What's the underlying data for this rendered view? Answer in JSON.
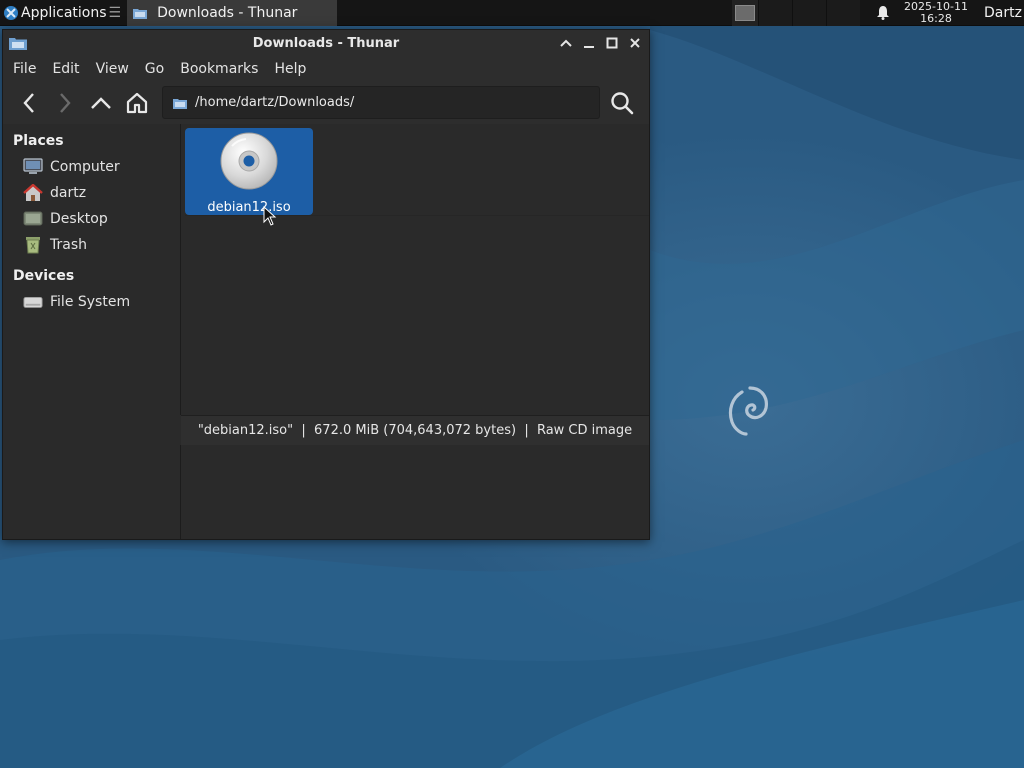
{
  "panel": {
    "applications_label": "Applications",
    "task_title": "Downloads - Thunar",
    "clock_date": "2025-10-11",
    "clock_time": "16:28",
    "user": "Dartz"
  },
  "window": {
    "title": "Downloads - Thunar",
    "controls": [
      "chevron-up-icon",
      "minimize-icon",
      "maximize-icon",
      "close-icon"
    ]
  },
  "menubar": {
    "items": [
      "File",
      "Edit",
      "View",
      "Go",
      "Bookmarks",
      "Help"
    ]
  },
  "toolbar": {
    "location": "/home/dartz/Downloads/"
  },
  "sidebar": {
    "places_header": "Places",
    "places": [
      {
        "label": "Computer",
        "icon": "computer-icon"
      },
      {
        "label": "dartz",
        "icon": "home-icon"
      },
      {
        "label": "Desktop",
        "icon": "desktop-icon"
      },
      {
        "label": "Trash",
        "icon": "trash-icon"
      }
    ],
    "devices_header": "Devices",
    "devices": [
      {
        "label": "File System",
        "icon": "drive-icon"
      }
    ]
  },
  "files": [
    {
      "name": "debian12.iso",
      "icon": "disc-icon",
      "selected": true
    }
  ],
  "statusbar": {
    "text": "\"debian12.iso\"  |  672.0 MiB (704,643,072 bytes)  |  Raw CD image"
  },
  "colors": {
    "selection": "#1d5ea6",
    "wallpaper": "#2b5f86",
    "panel": "#151515"
  }
}
